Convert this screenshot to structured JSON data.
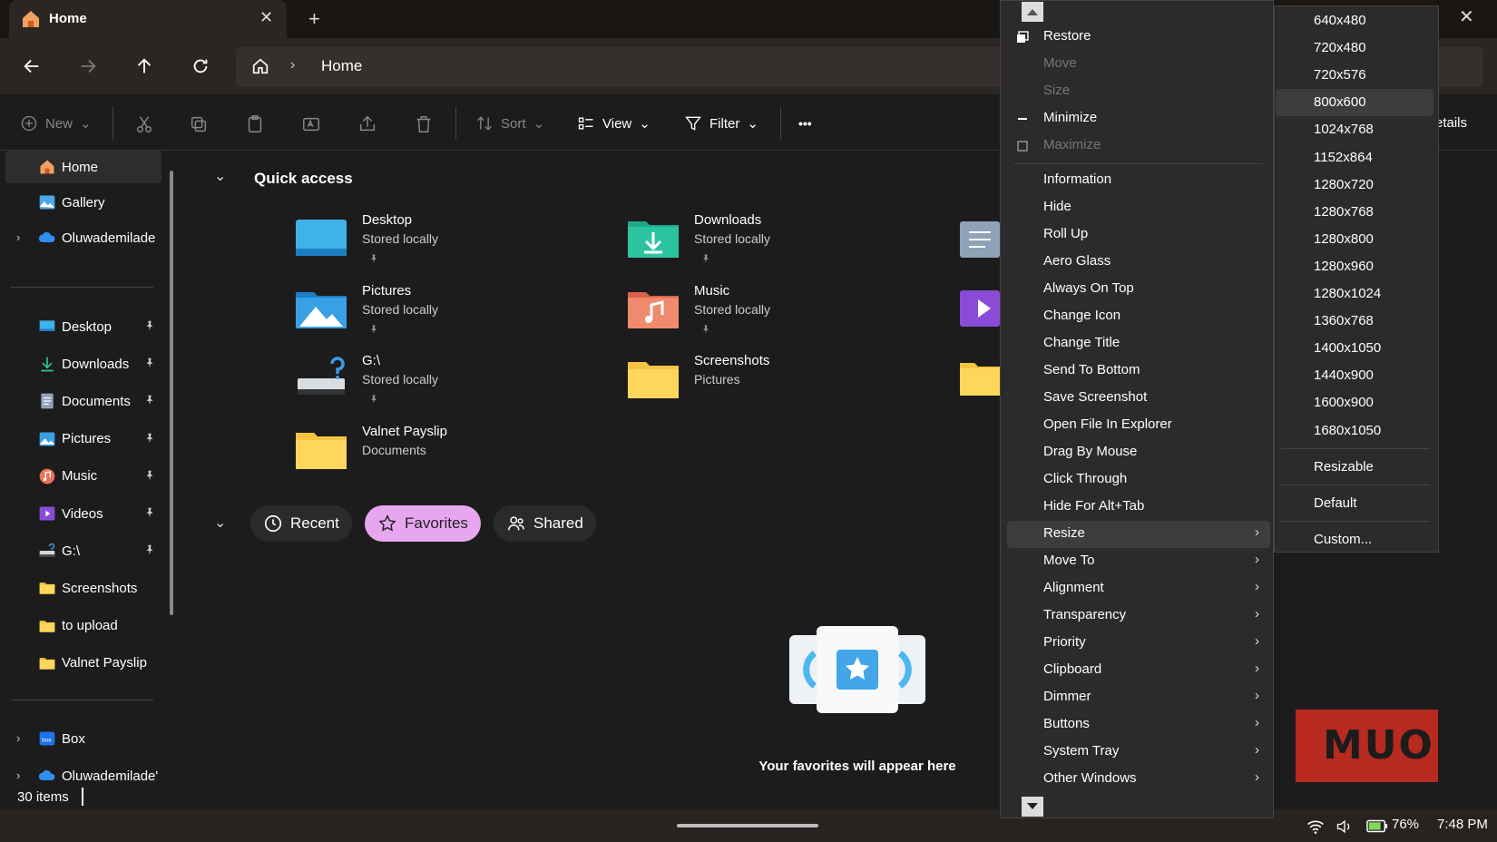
{
  "window": {
    "tab_title": "Home",
    "tab_close": "✕",
    "new_tab": "+",
    "close": "✕"
  },
  "address": {
    "chevron": "›",
    "path": "Home"
  },
  "toolbar": {
    "new_label": "New",
    "sort_label": "Sort",
    "view_label": "View",
    "filter_label": "Filter",
    "more": "•••",
    "details_label": "etails"
  },
  "sidebar": {
    "expand": "›",
    "top": [
      {
        "label": "Home",
        "icon": "home-icon"
      },
      {
        "label": "Gallery",
        "icon": "gallery-icon"
      },
      {
        "label": "Oluwademilade",
        "icon": "onedrive-icon"
      }
    ],
    "pinned": [
      {
        "label": "Desktop",
        "icon": "desktop-icon"
      },
      {
        "label": "Downloads",
        "icon": "downloads-icon"
      },
      {
        "label": "Documents",
        "icon": "documents-icon"
      },
      {
        "label": "Pictures",
        "icon": "pictures-icon"
      },
      {
        "label": "Music",
        "icon": "music-icon"
      },
      {
        "label": "Videos",
        "icon": "videos-icon"
      },
      {
        "label": "G:\\",
        "icon": "drive-icon"
      },
      {
        "label": "Screenshots",
        "icon": "folder-icon"
      },
      {
        "label": "to upload",
        "icon": "folder-icon"
      },
      {
        "label": "Valnet Payslip",
        "icon": "folder-icon"
      }
    ],
    "bottom": [
      {
        "label": "Box",
        "icon": "box-icon"
      },
      {
        "label": "Oluwademilade'",
        "icon": "onedrive-icon"
      }
    ]
  },
  "quick_access": {
    "title": "Quick access",
    "chevron": "⌄",
    "items": [
      {
        "name": "Desktop",
        "sub": "Stored locally"
      },
      {
        "name": "Downloads",
        "sub": "Stored locally"
      },
      {
        "name": "Pictures",
        "sub": "Stored locally"
      },
      {
        "name": "Music",
        "sub": "Stored locally"
      },
      {
        "name": "G:\\",
        "sub": "Stored locally"
      },
      {
        "name": "Screenshots",
        "sub": "Pictures"
      },
      {
        "name": "Valnet Payslip",
        "sub": "Documents"
      }
    ]
  },
  "pills": {
    "recent": "Recent",
    "favorites": "Favorites",
    "shared": "Shared"
  },
  "favorites_empty": "Your favorites will appear here",
  "status": {
    "items": "30 items"
  },
  "tray": {
    "battery": "76%",
    "time": "7:48 PM"
  },
  "menu": {
    "items": [
      {
        "label": "Restore",
        "disabled": false
      },
      {
        "label": "Move",
        "disabled": true
      },
      {
        "label": "Size",
        "disabled": true
      },
      {
        "label": "Minimize",
        "disabled": false
      },
      {
        "label": "Maximize",
        "disabled": true
      },
      {
        "label": "Information"
      },
      {
        "label": "Hide"
      },
      {
        "label": "Roll Up"
      },
      {
        "label": "Aero Glass"
      },
      {
        "label": "Always On Top"
      },
      {
        "label": "Change Icon"
      },
      {
        "label": "Change Title"
      },
      {
        "label": "Send To Bottom"
      },
      {
        "label": "Save Screenshot"
      },
      {
        "label": "Open File In Explorer"
      },
      {
        "label": "Drag By Mouse"
      },
      {
        "label": "Click Through"
      },
      {
        "label": "Hide For Alt+Tab"
      },
      {
        "label": "Resize"
      },
      {
        "label": "Move To"
      },
      {
        "label": "Alignment"
      },
      {
        "label": "Transparency"
      },
      {
        "label": "Priority"
      },
      {
        "label": "Clipboard"
      },
      {
        "label": "Dimmer"
      },
      {
        "label": "Buttons"
      },
      {
        "label": "System Tray"
      },
      {
        "label": "Other Windows"
      }
    ],
    "arrow": "›"
  },
  "submenu": {
    "sizes": [
      "640x480",
      "720x480",
      "720x576",
      "800x600",
      "1024x768",
      "1152x864",
      "1280x720",
      "1280x768",
      "1280x800",
      "1280x960",
      "1280x1024",
      "1360x768",
      "1400x1050",
      "1440x900",
      "1600x900",
      "1680x1050"
    ],
    "resizable": "Resizable",
    "default": "Default",
    "custom": "Custom..."
  },
  "watermark": "MUO"
}
